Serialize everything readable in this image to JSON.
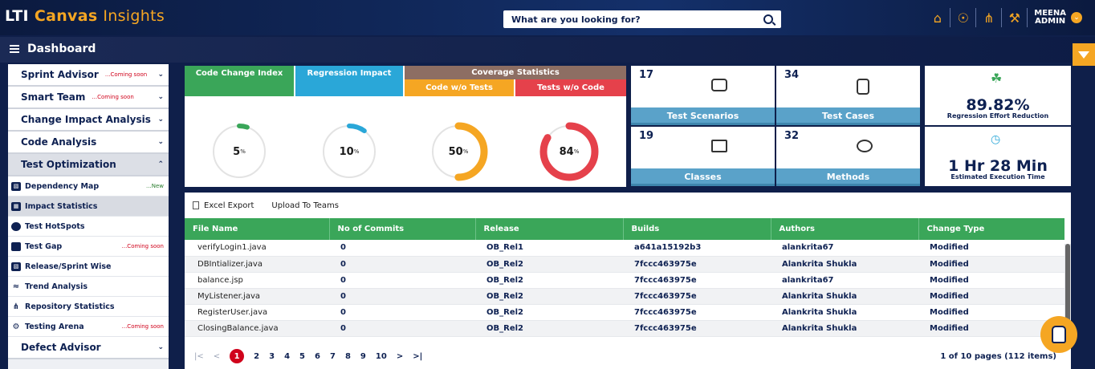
{
  "brand": {
    "lti": "LTI",
    "canvas": "Canvas",
    "insights": "Insights"
  },
  "search": {
    "placeholder": "What are you looking for?"
  },
  "header": {
    "icons": [
      "home-icon",
      "dashboard-icon",
      "repository-icon",
      "wrench-icon"
    ],
    "user_name": "MEENA",
    "user_role": "ADMIN"
  },
  "dashbar": {
    "title": "Dashboard"
  },
  "sidebar": {
    "sections": [
      {
        "label": "Sprint Advisor",
        "tag": "...Coming soon"
      },
      {
        "label": "Smart Team",
        "tag": "...Coming soon"
      },
      {
        "label": "Change Impact Analysis",
        "tag": ""
      },
      {
        "label": "Code Analysis",
        "tag": ""
      },
      {
        "label": "Test Optimization",
        "tag": ""
      }
    ],
    "items": [
      {
        "label": "Dependency Map",
        "tag": "...New",
        "icon": "bar-chart-icon"
      },
      {
        "label": "Impact Statistics",
        "tag": "",
        "icon": "grid-icon"
      },
      {
        "label": "Test HotSpots",
        "tag": "",
        "icon": "circle-icon"
      },
      {
        "label": "Test Gap",
        "tag": "...Coming soon",
        "icon": "monitor-icon"
      },
      {
        "label": "Release/Sprint Wise",
        "tag": "",
        "icon": "bar-chart-icon"
      },
      {
        "label": "Trend Analysis",
        "tag": "",
        "icon": "trend-icon"
      },
      {
        "label": "Repository Statistics",
        "tag": "",
        "icon": "repository-icon"
      },
      {
        "label": "Testing Arena",
        "tag": "...Coming soon",
        "icon": "arena-icon"
      }
    ],
    "last_section": {
      "label": "Defect Advisor"
    }
  },
  "metrics": {
    "code_change_index": {
      "title": "Code Change Index",
      "value": "5",
      "unit": "%",
      "percent": 5,
      "color": "#3aa659"
    },
    "regression_impact": {
      "title": "Regression Impact",
      "value": "10",
      "unit": "%",
      "percent": 10,
      "color": "#2aa7d8"
    },
    "coverage_title": "Coverage Statistics",
    "code_wo_tests": {
      "title": "Code w/o Tests",
      "value": "50",
      "unit": "%",
      "percent": 50,
      "color": "#f5a623"
    },
    "tests_wo_code": {
      "title": "Tests w/o Code",
      "value": "84",
      "unit": "%",
      "percent": 84,
      "color": "#e5414b"
    }
  },
  "tiles": [
    {
      "num": "17",
      "label": "Test Scenarios"
    },
    {
      "num": "34",
      "label": "Test Cases"
    },
    {
      "num": "19",
      "label": "Classes"
    },
    {
      "num": "32",
      "label": "Methods"
    }
  ],
  "kpis": {
    "regression": {
      "value": "89.82%",
      "label": "Regression Effort Reduction"
    },
    "execution": {
      "value": "1 Hr 28 Min",
      "label": "Estimated Execution Time"
    }
  },
  "toolbar": {
    "excel_label": "Excel Export",
    "teams_label": "Upload To Teams"
  },
  "table": {
    "columns": [
      "File Name",
      "No of Commits",
      "Release",
      "Builds",
      "Authors",
      "Change Type"
    ],
    "rows": [
      [
        "verifyLogin1.java",
        "0",
        "OB_Rel1",
        "a641a15192b3",
        "alankrita67",
        "Modified"
      ],
      [
        "DBIntializer.java",
        "0",
        "OB_Rel2",
        "7fccc463975e",
        "Alankrita Shukla",
        "Modified"
      ],
      [
        "balance.jsp",
        "0",
        "OB_Rel2",
        "7fccc463975e",
        "alankrita67",
        "Modified"
      ],
      [
        "MyListener.java",
        "0",
        "OB_Rel2",
        "7fccc463975e",
        "Alankrita Shukla",
        "Modified"
      ],
      [
        "RegisterUser.java",
        "0",
        "OB_Rel2",
        "7fccc463975e",
        "Alankrita Shukla",
        "Modified"
      ],
      [
        "ClosingBalance.java",
        "0",
        "OB_Rel2",
        "7fccc463975e",
        "Alankrita Shukla",
        "Modified"
      ]
    ]
  },
  "pager": {
    "first": "|<",
    "prev": "<",
    "next": ">",
    "last": ">|",
    "pages": [
      "1",
      "2",
      "3",
      "4",
      "5",
      "6",
      "7",
      "8",
      "9",
      "10"
    ],
    "current": "1",
    "info": "1 of 10 pages (112 items)"
  }
}
